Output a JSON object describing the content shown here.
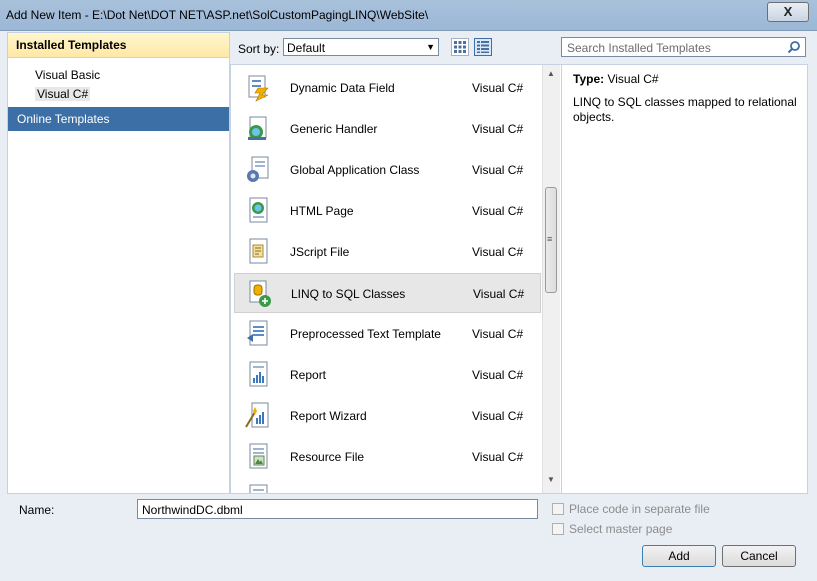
{
  "window": {
    "title": "Add New Item - E:\\Dot Net\\DOT NET\\ASP.net\\SolCustomPagingLINQ\\WebSite\\",
    "close_label": "X"
  },
  "left_pane": {
    "installed_header": "Installed Templates",
    "languages": [
      {
        "label": "Visual Basic",
        "selected": false
      },
      {
        "label": "Visual C#",
        "selected": true
      }
    ],
    "online_header": "Online Templates"
  },
  "toolbar": {
    "sort_label": "Sort by:",
    "sort_value": "Default"
  },
  "search": {
    "placeholder": "Search Installed Templates"
  },
  "templates": [
    {
      "name": "Dynamic Data Field",
      "lang": "Visual C#",
      "icon": "dynamic-data-field-icon",
      "selected": false
    },
    {
      "name": "Generic Handler",
      "lang": "Visual C#",
      "icon": "generic-handler-icon",
      "selected": false
    },
    {
      "name": "Global Application Class",
      "lang": "Visual C#",
      "icon": "global-application-class-icon",
      "selected": false
    },
    {
      "name": "HTML Page",
      "lang": "Visual C#",
      "icon": "html-page-icon",
      "selected": false
    },
    {
      "name": "JScript File",
      "lang": "Visual C#",
      "icon": "jscript-file-icon",
      "selected": false
    },
    {
      "name": "LINQ to SQL Classes",
      "lang": "Visual C#",
      "icon": "linq-to-sql-icon",
      "selected": true
    },
    {
      "name": "Preprocessed Text Template",
      "lang": "Visual C#",
      "icon": "preprocessed-text-template-icon",
      "selected": false
    },
    {
      "name": "Report",
      "lang": "Visual C#",
      "icon": "report-icon",
      "selected": false
    },
    {
      "name": "Report Wizard",
      "lang": "Visual C#",
      "icon": "report-wizard-icon",
      "selected": false
    },
    {
      "name": "Resource File",
      "lang": "Visual C#",
      "icon": "resource-file-icon",
      "selected": false
    }
  ],
  "details": {
    "type_label": "Type:",
    "type_value": "Visual C#",
    "description": "LINQ to SQL classes mapped to relational objects."
  },
  "bottom": {
    "name_label": "Name:",
    "name_value": "NorthwindDC.dbml",
    "place_code_label": "Place code in separate file",
    "select_master_label": "Select master page",
    "add_label": "Add",
    "cancel_label": "Cancel"
  }
}
